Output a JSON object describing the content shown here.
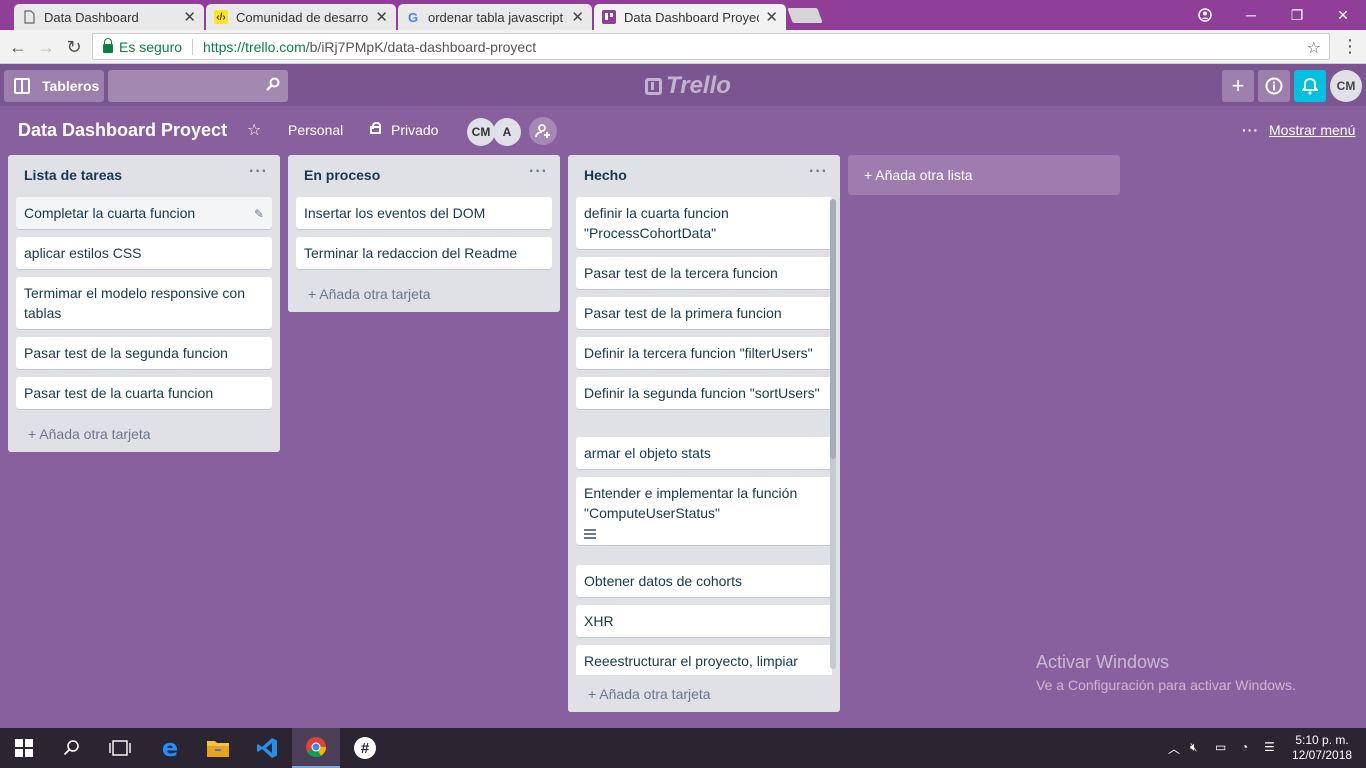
{
  "browser": {
    "tabs": [
      {
        "title": "Data Dashboard",
        "icon": "page-icon"
      },
      {
        "title": "Comunidad de desarrolla",
        "icon": "laboratoria-icon"
      },
      {
        "title": "ordenar tabla javascript -",
        "icon": "google-icon"
      },
      {
        "title": "Data Dashboard Proyect",
        "icon": "trello-icon"
      }
    ],
    "secure_label": "Es seguro",
    "url_host": "https://trello.com",
    "url_path": "/b/iRj7PMpK/data-dashboard-proyect"
  },
  "header": {
    "boards_label": "Tableros",
    "logo_text": "Trello",
    "avatar": "CM"
  },
  "board": {
    "title": "Data Dashboard Proyect",
    "team": "Personal",
    "visibility": "Privado",
    "members": [
      "CM",
      "A"
    ],
    "show_menu": "Mostrar menú",
    "add_list": "+ Añada otra lista",
    "lists": [
      {
        "title": "Lista de tareas",
        "cards": [
          "Completar la cuarta funcion",
          "aplicar estilos CSS",
          "Termimar el modelo responsive con tablas",
          "Pasar test de la segunda funcion",
          "Pasar test de la cuarta funcion"
        ],
        "add_card": "+ Añada otra tarjeta"
      },
      {
        "title": "En proceso",
        "cards": [
          "Insertar los eventos del DOM",
          "Terminar la redaccion del Readme"
        ],
        "add_card": "+ Añada otra tarjeta"
      },
      {
        "title": "Hecho",
        "cards": [
          "definir la cuarta funcion \"ProcessCohortData\"",
          "Pasar test de la tercera funcion",
          "Pasar test de la primera funcion",
          "Definir la tercera funcion \"filterUsers\"",
          "Definir la segunda funcion \"sortUsers\"",
          "armar el objeto stats",
          "Entender e implementar la función \"ComputeUserStatus\"",
          "Obtener datos de cohorts",
          "XHR",
          "Reeestructurar el proyecto, limpiar"
        ],
        "add_card": "+ Añada otra tarjeta"
      }
    ]
  },
  "watermark": {
    "line1": "Activar Windows",
    "line2": "Ve a Configuración para activar Windows."
  },
  "taskbar": {
    "time": "5:10 p. m.",
    "date": "12/07/2018"
  },
  "colors": {
    "board_bg": "#89609e",
    "header_bg": "#7b5590",
    "tabstrip_bg": "#8f3f97",
    "list_bg": "#dfe1e6",
    "notification": "#00c2e0"
  }
}
